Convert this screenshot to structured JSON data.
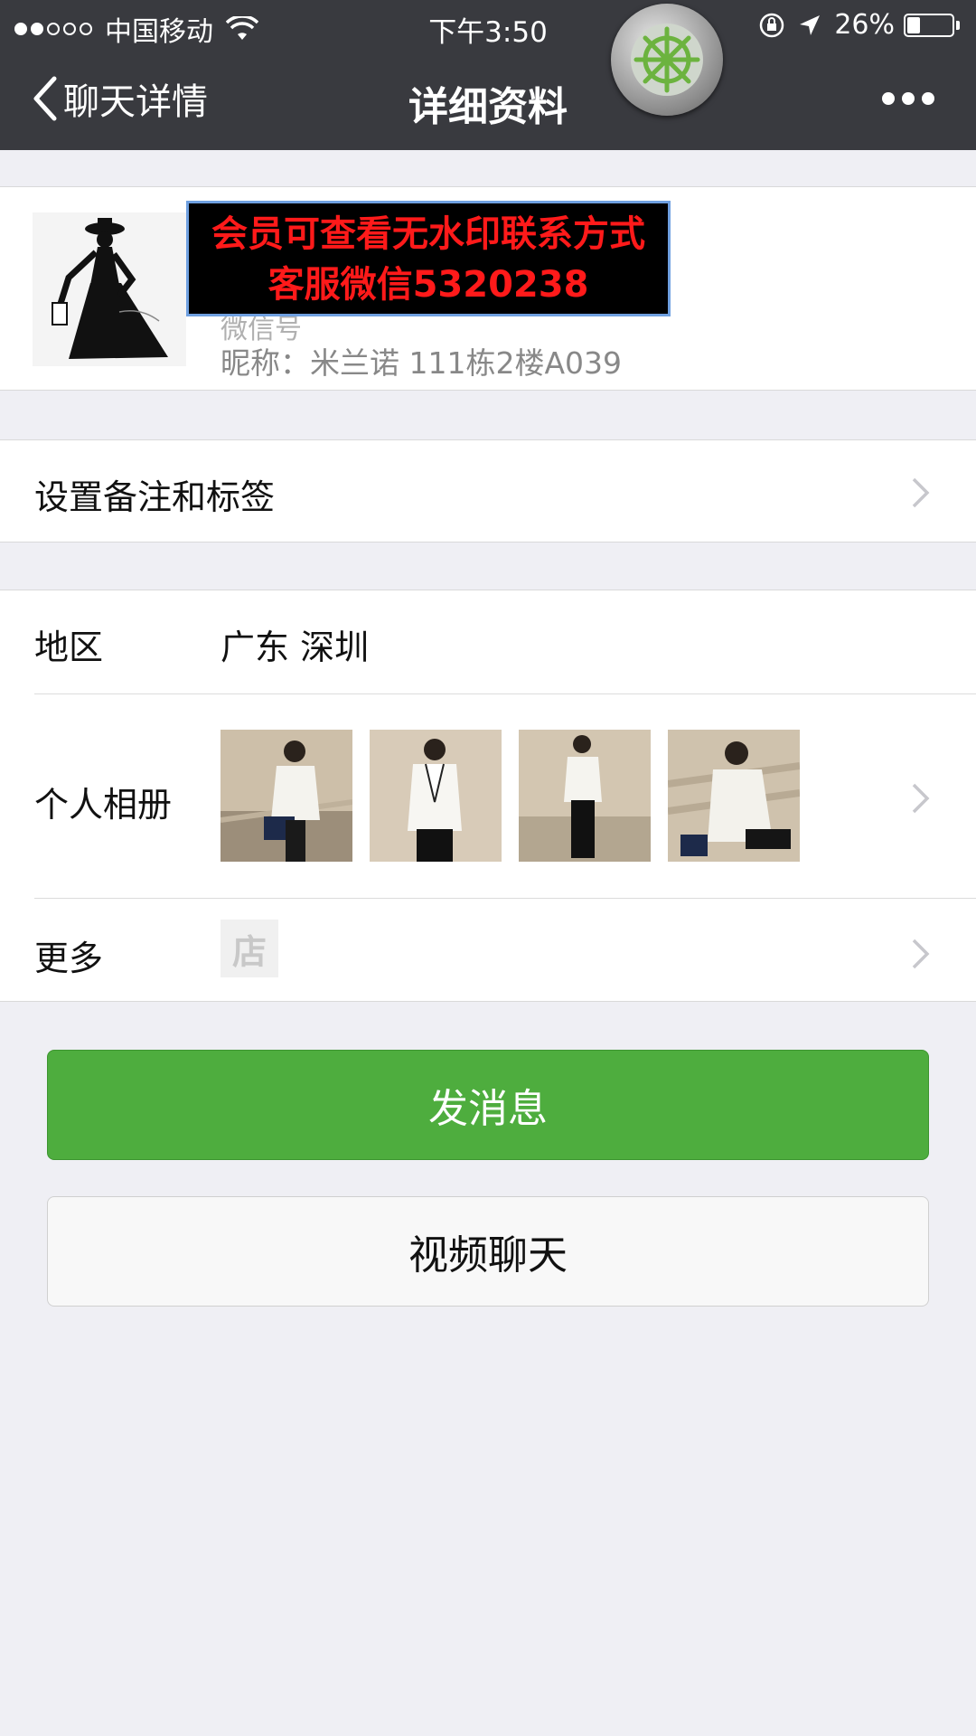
{
  "status_bar": {
    "carrier": "中国移动",
    "time": "下午3:50",
    "battery": "26%",
    "battery_level": 0.26
  },
  "nav": {
    "back_label": "聊天详情",
    "title": "详细资料"
  },
  "profile": {
    "watermark_line1": "会员可查看无水印联系方式",
    "watermark_line2": "客服微信5320238",
    "wechat_id_label_partial": "微信号",
    "nickname": "昵称：米兰诺 111栋2楼A039"
  },
  "remark_row": {
    "label": "设置备注和标签"
  },
  "region_row": {
    "label": "地区",
    "value": "广东 深圳"
  },
  "album_row": {
    "label": "个人相册",
    "photo_count": 4
  },
  "more_row": {
    "label": "更多",
    "shop_icon_text": "店"
  },
  "buttons": {
    "send_message": "发消息",
    "video_chat": "视频聊天"
  },
  "colors": {
    "nav_bg": "#393a3f",
    "primary_green": "#4ead3e",
    "page_bg": "#efeff4"
  }
}
